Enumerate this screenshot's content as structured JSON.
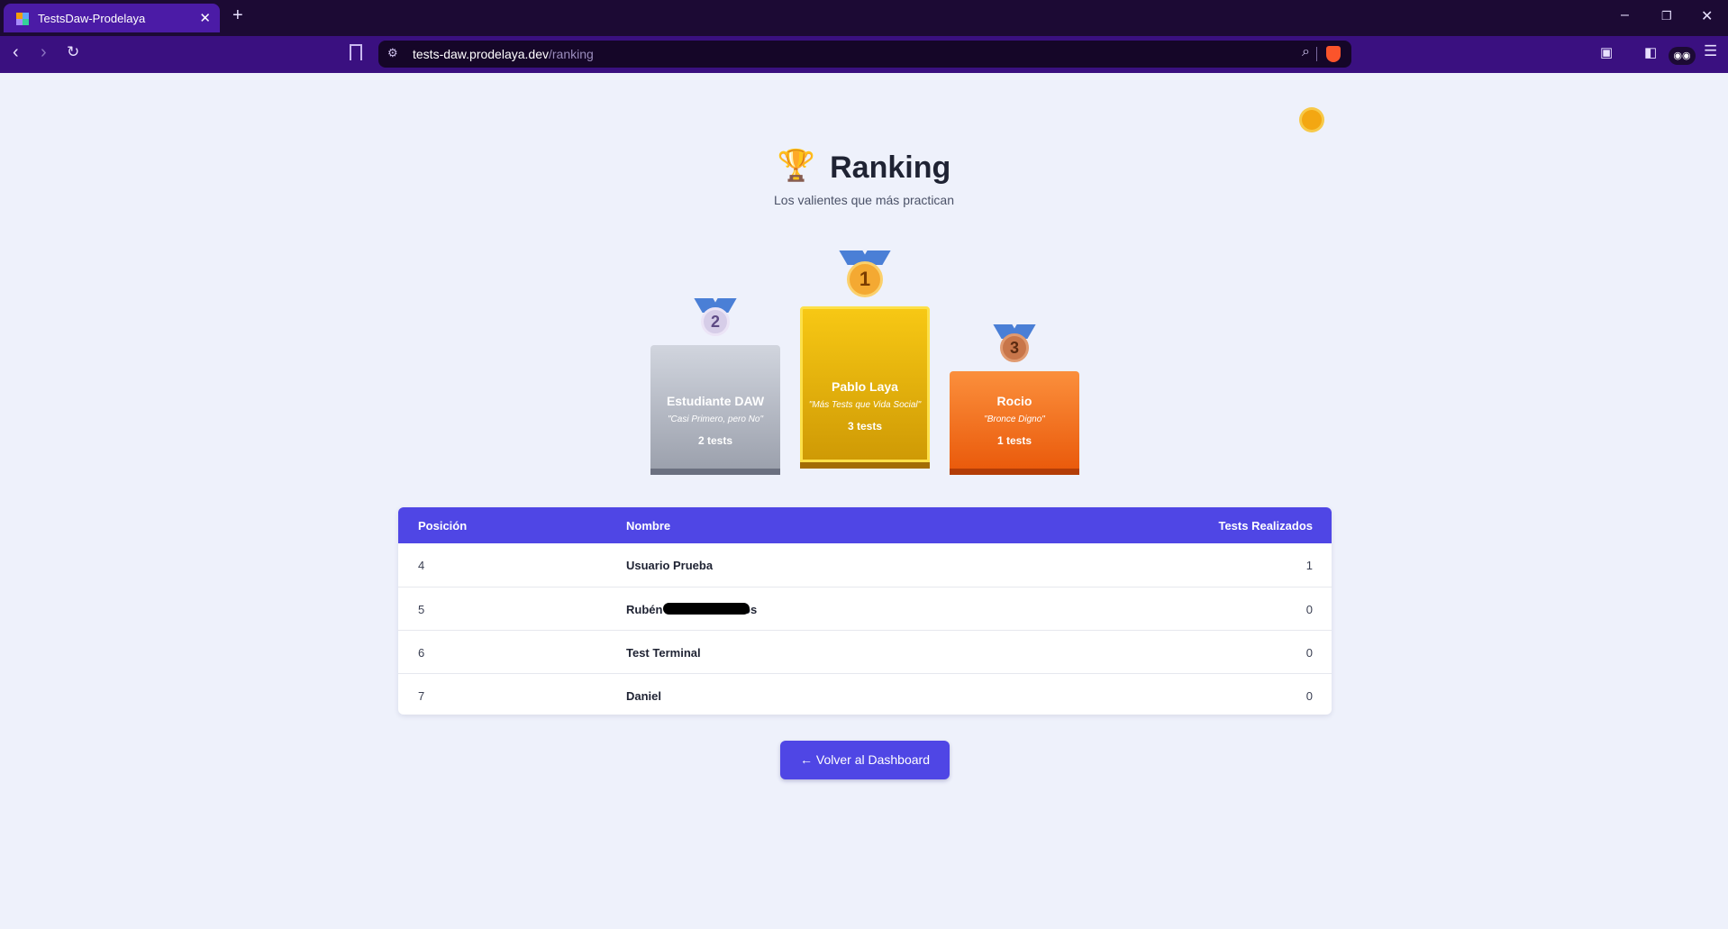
{
  "browser": {
    "tab_title": "TestsDaw-Prodelaya",
    "url_host": "tests-daw.prodelaya.dev",
    "url_path": "/ranking"
  },
  "page": {
    "title": "Ranking",
    "subtitle": "Los valientes que más practican"
  },
  "podium": {
    "first": {
      "position": "1",
      "name": "Pablo Laya",
      "motto": "\"Más Tests que Vida Social\"",
      "tests": "3 tests"
    },
    "second": {
      "position": "2",
      "name": "Estudiante DAW",
      "motto": "\"Casi Primero, pero No\"",
      "tests": "2 tests"
    },
    "third": {
      "position": "3",
      "name": "Rocio",
      "motto": "\"Bronce Digno\"",
      "tests": "1 tests"
    }
  },
  "table": {
    "headers": {
      "position": "Posición",
      "name": "Nombre",
      "tests": "Tests Realizados"
    },
    "rows": [
      {
        "position": "4",
        "name": "Usuario Prueba",
        "tests": "1"
      },
      {
        "position": "5",
        "name": "Rubén Martín Novalbos",
        "tests": "0"
      },
      {
        "position": "6",
        "name": "Test Terminal",
        "tests": "0"
      },
      {
        "position": "7",
        "name": "Daniel",
        "tests": "0"
      }
    ]
  },
  "actions": {
    "back_label": "← Volver al Dashboard"
  },
  "colors": {
    "accent": "#4f46e5",
    "gold": "#eab308",
    "silver": "#9ca3af",
    "bronze": "#f97316"
  }
}
